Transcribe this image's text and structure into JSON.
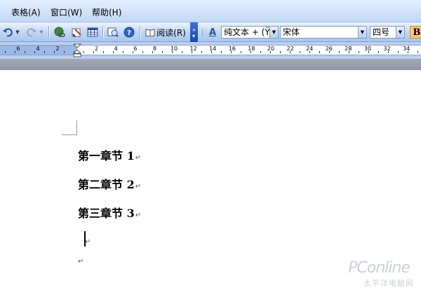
{
  "menu": [
    {
      "label": "表格(A)"
    },
    {
      "label": "窗口(W)"
    },
    {
      "label": "帮助(H)"
    }
  ],
  "toolbar": {
    "read_label": "阅读(R)",
    "style_value": "纯文本 + (Ÿ",
    "font_value": "宋体",
    "size_value": "四号",
    "bold_label": "B",
    "style_icon_label": "A"
  },
  "ruler": {
    "left_numbers": [
      "8",
      "6",
      "4",
      "2"
    ],
    "right_numbers": [
      "2",
      "4",
      "6",
      "8",
      "10",
      "12",
      "14",
      "16",
      "18",
      "20",
      "22",
      "24",
      "26",
      "28",
      "30",
      "32",
      "34"
    ]
  },
  "document": {
    "paragraphs": [
      {
        "text": "第一章节 1"
      },
      {
        "text": "第二章节 2"
      },
      {
        "text": "第三章节 3"
      }
    ],
    "paragraph_mark": "↵"
  },
  "watermark": {
    "brand": "PConline",
    "subtitle": "太平洋电脑网"
  }
}
